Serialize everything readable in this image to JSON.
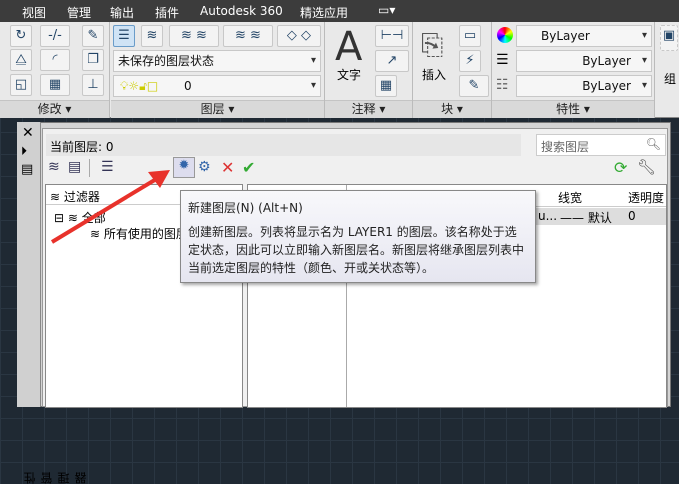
{
  "menu": {
    "items": [
      "视图",
      "管理",
      "输出",
      "插件",
      "Autodesk 360",
      "精选应用"
    ]
  },
  "ribbon": {
    "panels": {
      "modify": "修改",
      "layers": "图层",
      "annotation": "注释",
      "block": "块",
      "properties": "特性",
      "group": "组"
    },
    "layer_state": "未保存的图层状态",
    "current_layer_combo": "0",
    "text_label": "文字",
    "insert_label": "插入",
    "color": "ByLayer",
    "linetype": "ByLayer",
    "lineweight": "ByLayer"
  },
  "palette": {
    "side_title": "性管理器",
    "current_layer": "当前图层: 0",
    "search_placeholder": "搜索图层",
    "filter_header": "过滤器",
    "tree": {
      "all": "全部",
      "used": "所有使用的图层"
    },
    "columns": {
      "lineweight": "线宽",
      "transparency": "透明度"
    },
    "row": {
      "truncated": "u...",
      "lineweight": "—— 默认",
      "transparency": "0"
    }
  },
  "tooltip": {
    "title": "新建图层(N) (Alt+N)",
    "body": "创建新图层。列表将显示名为 LAYER1 的图层。该名称处于选定状态，因此可以立即输入新图层名。新图层将继承图层列表中当前选定图层的特性（颜色、开或关状态等）。"
  }
}
